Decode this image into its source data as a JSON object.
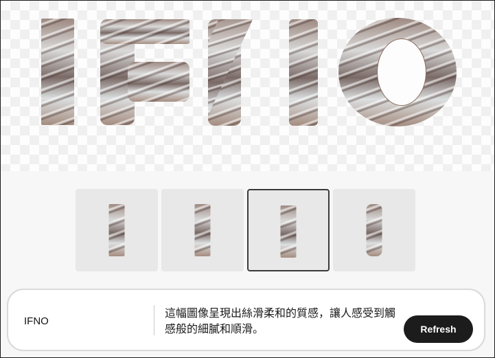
{
  "preview": {
    "word": "IFNO",
    "letters": [
      "I",
      "F",
      "N",
      "O"
    ],
    "style_description": "swirling silky marble-textured 3D letters on transparent background"
  },
  "thumbnails": [
    {
      "label": "I variant 1",
      "selected": false
    },
    {
      "label": "I variant 2",
      "selected": false
    },
    {
      "label": "I variant 3",
      "selected": true
    },
    {
      "label": "I variant 4",
      "selected": false
    }
  ],
  "prompt_bar": {
    "title": "IFNO",
    "description": "這幅圖像呈現出絲滑柔和的質感，讓人感受到觸感般的細膩和順滑。",
    "refresh_label": "Refresh"
  },
  "colors": {
    "button_bg": "#1c1c1c",
    "button_text": "#ffffff",
    "selected_border": "#3a3a3a",
    "thumb_bg": "#e8e8e8"
  }
}
